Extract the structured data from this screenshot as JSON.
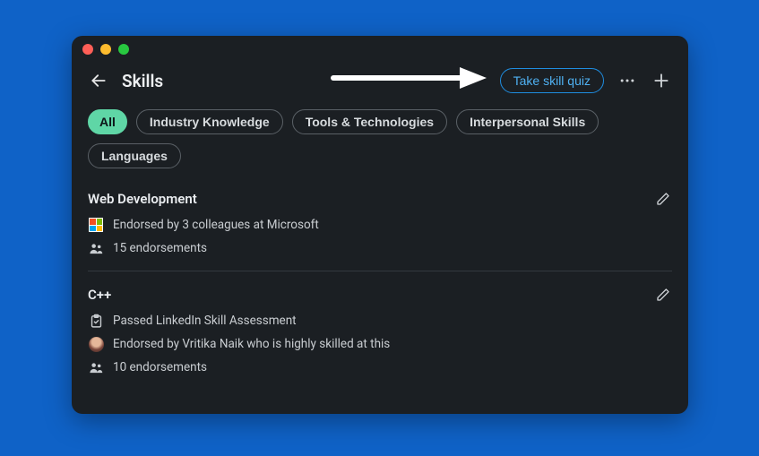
{
  "header": {
    "title": "Skills",
    "quiz_button": "Take skill quiz"
  },
  "filters": [
    {
      "label": "All",
      "active": true
    },
    {
      "label": "Industry Knowledge",
      "active": false
    },
    {
      "label": "Tools & Technologies",
      "active": false
    },
    {
      "label": "Interpersonal Skills",
      "active": false
    },
    {
      "label": "Languages",
      "active": false
    }
  ],
  "skills": [
    {
      "name": "Web Development",
      "details": [
        {
          "icon": "microsoft-logo",
          "text": "Endorsed by 3 colleagues at Microsoft"
        },
        {
          "icon": "people-icon",
          "text": "15 endorsements"
        }
      ]
    },
    {
      "name": "C++",
      "details": [
        {
          "icon": "clipboard-check-icon",
          "text": "Passed LinkedIn Skill Assessment"
        },
        {
          "icon": "avatar",
          "text": "Endorsed by Vritika Naik who is highly skilled at this"
        },
        {
          "icon": "people-icon",
          "text": "10 endorsements"
        }
      ]
    }
  ]
}
